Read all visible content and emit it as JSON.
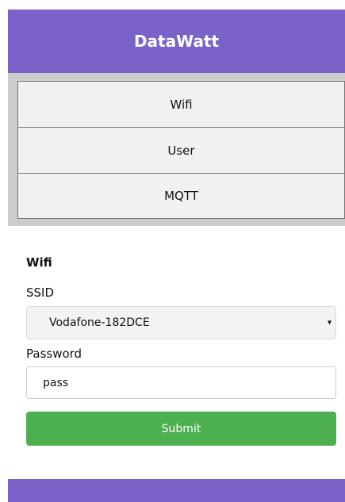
{
  "header": {
    "title": "DataWatt"
  },
  "nav": {
    "items": [
      {
        "label": "Wifi"
      },
      {
        "label": "User"
      },
      {
        "label": "MQTT"
      }
    ]
  },
  "form": {
    "title": "Wifi",
    "ssid_label": "SSID",
    "ssid_value": "Vodafone-182DCE",
    "password_label": "Password",
    "password_value": "pass",
    "submit_label": "Submit"
  },
  "colors": {
    "header_bg": "#7a62c9",
    "nav_bg": "#cccccc",
    "submit_bg": "#4caf50"
  }
}
